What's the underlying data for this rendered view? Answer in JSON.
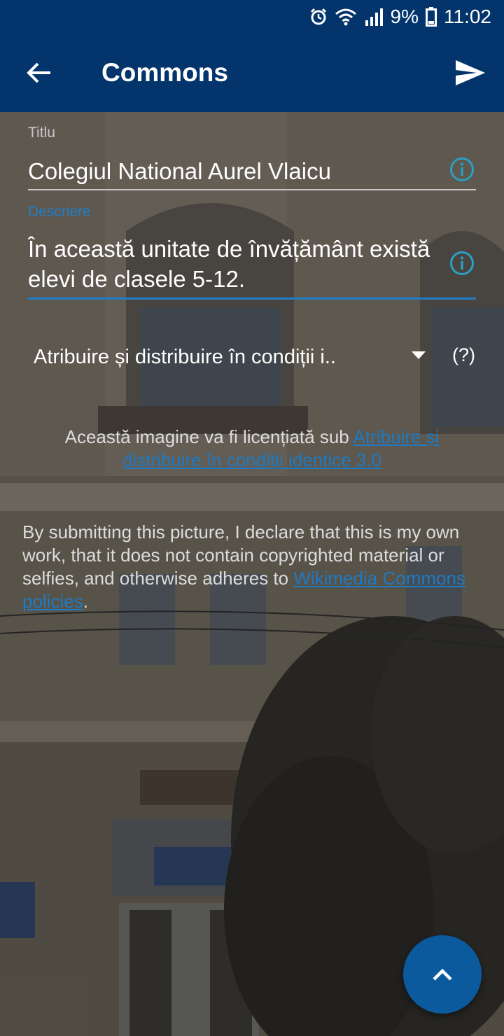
{
  "status_bar": {
    "battery_percent": "9%",
    "time": "11:02",
    "icons": [
      "alarm-icon",
      "wifi-icon",
      "signal-icon",
      "battery-icon"
    ]
  },
  "app_bar": {
    "title": "Commons",
    "back_icon": "arrow-left-icon",
    "send_icon": "send-icon",
    "background_color": "#03346b"
  },
  "form": {
    "title_label": "Titlu",
    "title_value": "Colegiul National Aurel Vlaicu",
    "description_label": "Descriere",
    "description_value": "În această unitate de învățământ există elevi de clasele 5-12.",
    "accent_color": "#1f7fc9",
    "info_icon": "info-icon"
  },
  "license": {
    "selected": "Atribuire și distribuire în condiții i..",
    "help_label": "(?)",
    "note_prefix": "Această imagine va fi licențiată sub ",
    "note_link": "Atribuire și distribuire în condiții identice 3.0"
  },
  "declaration": {
    "text": "By submitting this picture, I declare that this is my own work, that it does not contain copyrighted material or selfies, and otherwise adheres to ",
    "link": "Wikimedia Commons policies",
    "suffix": "."
  },
  "fab": {
    "icon": "chevron-up-icon",
    "color": "#0b5a9e"
  }
}
